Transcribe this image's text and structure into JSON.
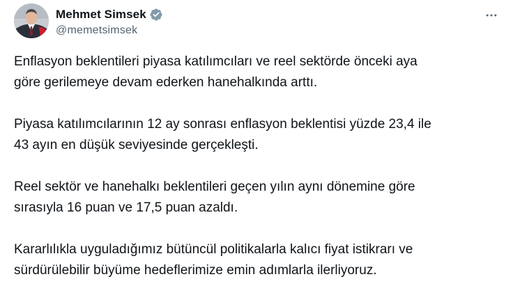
{
  "author": {
    "display_name": "Mehmet Simsek",
    "handle": "@memetsimsek",
    "verified_icon": "verified-badge-icon",
    "avatar_icon": "avatar"
  },
  "actions": {
    "more_icon": "more-options-icon"
  },
  "tweet": {
    "paragraphs": [
      "Enflasyon beklentileri piyasa katılımcıları ve reel sektörde önceki aya\ngöre gerilemeye devam ederken hanehalkında arttı.",
      "Piyasa katılımcılarının 12 ay sonrası enflasyon beklentisi yüzde 23,4 ile\n43 ayın en düşük seviyesinde gerçekleşti.",
      "Reel sektör ve hanehalkı beklentileri geçen yılın aynı dönemine göre\nsırasıyla 16 puan ve 17,5 puan azaldı.",
      "Kararlılıkla uyguladığımız bütüncül politikalarla kalıcı fiyat istikrarı ve\nsürdürülebilir büyüme hedeflerimize emin adımlarla ilerliyoruz."
    ]
  },
  "colors": {
    "text_primary": "#0f1419",
    "text_secondary": "#536471",
    "verified_badge": "#829aab",
    "background": "#ffffff"
  }
}
